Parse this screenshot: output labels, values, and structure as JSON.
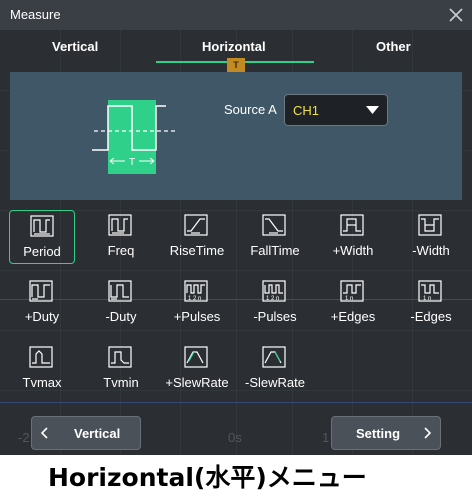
{
  "window": {
    "title": "Measure"
  },
  "tabs": [
    {
      "label": "Vertical"
    },
    {
      "label": "Horizontal"
    },
    {
      "label": "Other"
    }
  ],
  "active_tab": "Horizontal",
  "trigger_marker": "T",
  "diagram": {
    "period_symbol": "T"
  },
  "source": {
    "label": "Source A",
    "value": "CH1"
  },
  "measurements": [
    {
      "label": "Period",
      "icon": "period-icon"
    },
    {
      "label": "Freq",
      "icon": "freq-icon"
    },
    {
      "label": "RiseTime",
      "icon": "risetime-icon"
    },
    {
      "label": "FallTime",
      "icon": "falltime-icon"
    },
    {
      "label": "+Width",
      "icon": "pos-width-icon"
    },
    {
      "label": "-Width",
      "icon": "neg-width-icon"
    },
    {
      "label": "+Duty",
      "icon": "pos-duty-icon"
    },
    {
      "label": "-Duty",
      "icon": "neg-duty-icon"
    },
    {
      "label": "+Pulses",
      "icon": "pos-pulses-icon"
    },
    {
      "label": "-Pulses",
      "icon": "neg-pulses-icon"
    },
    {
      "label": "+Edges",
      "icon": "pos-edges-icon"
    },
    {
      "label": "-Edges",
      "icon": "neg-edges-icon"
    },
    {
      "label": "Tvmax",
      "icon": "tvmax-icon"
    },
    {
      "label": "Tvmin",
      "icon": "tvmin-icon"
    },
    {
      "label": "+SlewRate",
      "icon": "pos-slewrate-icon"
    },
    {
      "label": "-SlewRate",
      "icon": "neg-slewrate-icon"
    }
  ],
  "selected_measurement": "Period",
  "nav": {
    "prev_label": "Vertical",
    "next_label": "Setting"
  },
  "background_axis": {
    "left": "-2",
    "center": "0s",
    "right": "1"
  },
  "caption": "Horizontal(水平)メニュー",
  "colors": {
    "accent": "#2ed08a",
    "source_text": "#f1e04a",
    "panel": "#3f5766"
  }
}
